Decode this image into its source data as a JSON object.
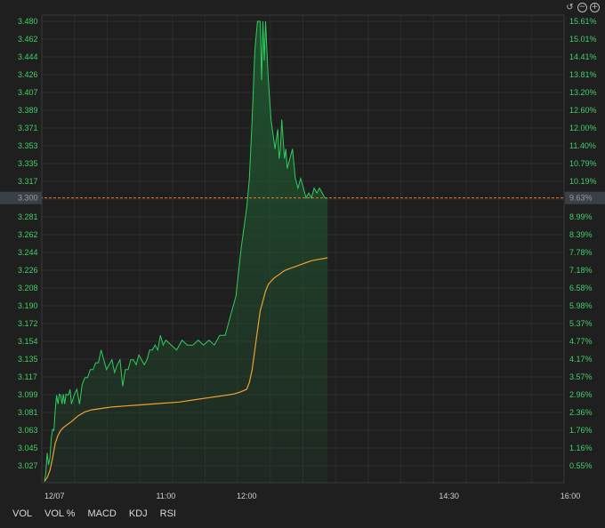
{
  "controls": {
    "reset_icon": "undo-icon",
    "zoom_out_icon": "zoom-out-icon",
    "zoom_in_icon": "zoom-in-icon",
    "reset_glyph": "↺",
    "zoom_out_glyph": "−",
    "zoom_in_glyph": "+"
  },
  "indicators": [
    "VOL",
    "VOL %",
    "MACD",
    "KDJ",
    "RSI"
  ],
  "colors": {
    "price_line": "#2ecc5f",
    "avg_line": "#f0a030",
    "grid": "#2c2c2c",
    "current_line": "#e07a2a",
    "fill": "#1f5a30"
  },
  "chart_data": {
    "type": "line",
    "title": "",
    "y_left_ticks": [
      "3.480",
      "3.462",
      "3.444",
      "3.426",
      "3.407",
      "3.389",
      "3.371",
      "3.353",
      "3.335",
      "3.317",
      "3.300",
      "3.281",
      "3.262",
      "3.244",
      "3.226",
      "3.208",
      "3.190",
      "3.172",
      "3.154",
      "3.135",
      "3.117",
      "3.099",
      "3.081",
      "3.063",
      "3.045",
      "3.027"
    ],
    "y_right_ticks": [
      "15.61%",
      "15.01%",
      "14.41%",
      "13.81%",
      "13.20%",
      "12.60%",
      "12.00%",
      "11.40%",
      "10.79%",
      "10.19%",
      "9.63%",
      "8.99%",
      "8.39%",
      "7.78%",
      "7.18%",
      "6.58%",
      "5.98%",
      "5.37%",
      "4.77%",
      "4.17%",
      "3.57%",
      "2.96%",
      "2.36%",
      "1.76%",
      "1.16%",
      "0.55%"
    ],
    "x_ticks": [
      "12/07",
      "11:00",
      "12:00",
      "14:30",
      "16:00"
    ],
    "ylim": [
      3.011,
      3.48
    ],
    "current_value": 3.3,
    "current_label": "3.300",
    "current_pct_label": "9.63%",
    "session_minutes": 390,
    "x_tick_minutes": [
      0,
      90,
      150,
      300,
      390
    ],
    "series": [
      {
        "name": "",
        "role": "price",
        "x": [
          0,
          1,
          2,
          3,
          4,
          5,
          6,
          7,
          8,
          9,
          10,
          11,
          12,
          13,
          14,
          15,
          16,
          17,
          18,
          19,
          20,
          22,
          24,
          26,
          28,
          30,
          32,
          34,
          36,
          38,
          40,
          42,
          44,
          46,
          48,
          50,
          52,
          54,
          56,
          58,
          60,
          62,
          64,
          66,
          68,
          70,
          72,
          74,
          76,
          78,
          80,
          82,
          84,
          86,
          88,
          90,
          94,
          98,
          102,
          106,
          110,
          114,
          118,
          122,
          126,
          130,
          134,
          138,
          142,
          146,
          150,
          152,
          154,
          156,
          158,
          160,
          161,
          162,
          163,
          164,
          165,
          166,
          167,
          168,
          169,
          170,
          171,
          172,
          173,
          174,
          175,
          176,
          177,
          178,
          179,
          180,
          182,
          184,
          186,
          188,
          190,
          192,
          194,
          196,
          198,
          200,
          202,
          204,
          206,
          208,
          210
        ],
        "y": [
          3.011,
          3.02,
          3.04,
          3.028,
          3.035,
          3.055,
          3.064,
          3.063,
          3.084,
          3.099,
          3.09,
          3.1,
          3.099,
          3.09,
          3.1,
          3.09,
          3.1,
          3.099,
          3.1,
          3.105,
          3.09,
          3.099,
          3.105,
          3.09,
          3.11,
          3.117,
          3.117,
          3.125,
          3.125,
          3.132,
          3.132,
          3.145,
          3.135,
          3.125,
          3.13,
          3.135,
          3.122,
          3.13,
          3.135,
          3.108,
          3.125,
          3.125,
          3.135,
          3.135,
          3.13,
          3.14,
          3.135,
          3.13,
          3.135,
          3.145,
          3.145,
          3.15,
          3.145,
          3.16,
          3.15,
          3.155,
          3.15,
          3.145,
          3.155,
          3.15,
          3.15,
          3.155,
          3.15,
          3.155,
          3.15,
          3.16,
          3.16,
          3.18,
          3.2,
          3.25,
          3.29,
          3.32,
          3.38,
          3.45,
          3.48,
          3.48,
          3.42,
          3.48,
          3.44,
          3.48,
          3.45,
          3.42,
          3.4,
          3.38,
          3.37,
          3.36,
          3.35,
          3.36,
          3.37,
          3.34,
          3.35,
          3.38,
          3.36,
          3.34,
          3.35,
          3.33,
          3.34,
          3.35,
          3.32,
          3.31,
          3.32,
          3.31,
          3.3,
          3.305,
          3.3,
          3.31,
          3.305,
          3.31,
          3.305,
          3.3,
          3.3
        ]
      },
      {
        "name": "",
        "role": "average",
        "x": [
          0,
          2,
          4,
          6,
          8,
          10,
          12,
          14,
          16,
          18,
          20,
          25,
          30,
          35,
          40,
          45,
          50,
          60,
          70,
          80,
          90,
          100,
          110,
          120,
          130,
          140,
          145,
          150,
          152,
          154,
          156,
          158,
          160,
          162,
          164,
          166,
          168,
          170,
          174,
          178,
          182,
          186,
          190,
          194,
          198,
          202,
          206,
          210
        ],
        "y": [
          3.011,
          3.015,
          3.022,
          3.035,
          3.05,
          3.058,
          3.063,
          3.066,
          3.068,
          3.07,
          3.072,
          3.078,
          3.082,
          3.084,
          3.085,
          3.086,
          3.087,
          3.088,
          3.089,
          3.09,
          3.091,
          3.092,
          3.094,
          3.096,
          3.098,
          3.1,
          3.102,
          3.105,
          3.112,
          3.125,
          3.145,
          3.165,
          3.185,
          3.195,
          3.205,
          3.212,
          3.215,
          3.218,
          3.222,
          3.226,
          3.228,
          3.23,
          3.232,
          3.234,
          3.236,
          3.237,
          3.238,
          3.239
        ]
      }
    ],
    "grid": true,
    "legend": "none"
  }
}
